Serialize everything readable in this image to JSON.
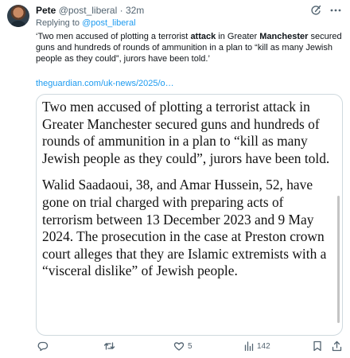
{
  "tweet": {
    "author_name": "Pete",
    "author_handle": "@post_liberal",
    "separator": "·",
    "time": "32m",
    "replying_label": "Replying to",
    "replying_handle": "@post_liberal",
    "text_1": "‘Two men accused of plotting a terrorist ",
    "text_bold_1": "attack",
    "text_2": " in Greater ",
    "text_bold_2": "Manchester",
    "text_3": " secured guns and hundreds of rounds of ammunition in a plan to “kill as many Jewish people as they could”, jurors have been told.’",
    "link_text": "theguardian.com/uk-news/2025/o…"
  },
  "article": {
    "paragraph_1": "Two men accused of plotting a terrorist attack in Greater Manchester secured guns and hundreds of rounds of ammunition in a plan to “kill as many Jewish people as they could”, jurors have been told.",
    "paragraph_2": "Walid Saadaoui, 38, and Amar Hussein, 52, have gone on trial charged with preparing acts of terrorism between 13 December 2023 and 9 May 2024. The prosecution in the case at Preston crown court alleges that they are Islamic extremists with a “visceral dislike” of Jewish people."
  },
  "actions": {
    "reply_count": "",
    "retweet_count": "",
    "like_count": "5",
    "view_count": "142"
  },
  "icons": {
    "header": [
      "grok-icon",
      "more-icon"
    ],
    "actions": [
      "reply-icon",
      "retweet-icon",
      "like-icon",
      "views-icon",
      "bookmark-icon",
      "share-icon"
    ]
  },
  "colors": {
    "link": "#1d9bf0",
    "secondary_text": "#536471",
    "primary_text": "#0f1419",
    "border": "#cfd9de"
  }
}
